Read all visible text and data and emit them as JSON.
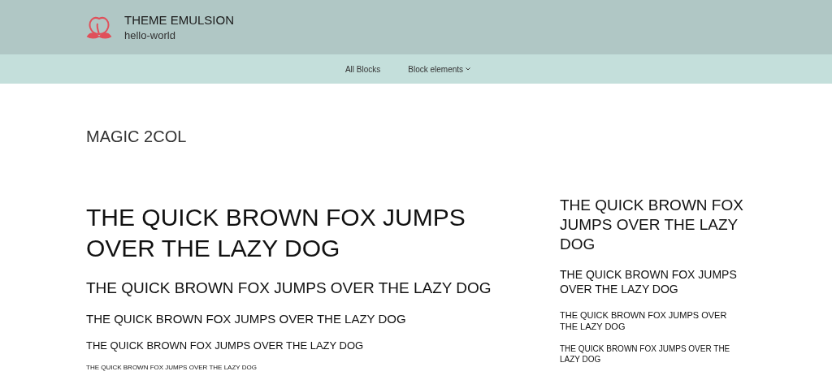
{
  "site": {
    "title": "THEME EMULSION",
    "subtitle": "hello-world"
  },
  "nav": [
    {
      "label": "All Blocks",
      "kind": "link"
    },
    {
      "label": "Block elements",
      "kind": "dropdown"
    }
  ],
  "page_title": "MAGIC 2COL",
  "main_column": {
    "headings": [
      "THE QUICK BROWN FOX JUMPS OVER THE LAZY DOG",
      "THE QUICK BROWN FOX JUMPS OVER THE LAZY DOG",
      "THE QUICK BROWN FOX JUMPS OVER THE LAZY DOG",
      "THE QUICK BROWN FOX JUMPS OVER THE LAZY DOG",
      "THE QUICK BROWN FOX JUMPS OVER THE LAZY DOG"
    ]
  },
  "side_column": {
    "headings": [
      "THE QUICK BROWN FOX JUMPS OVER THE LAZY DOG",
      "THE QUICK BROWN FOX JUMPS OVER THE LAZY DOG",
      "THE QUICK BROWN FOX JUMPS OVER THE LAZY DOG",
      "THE QUICK BROWN FOX JUMPS OVER THE LAZY DOG"
    ]
  }
}
